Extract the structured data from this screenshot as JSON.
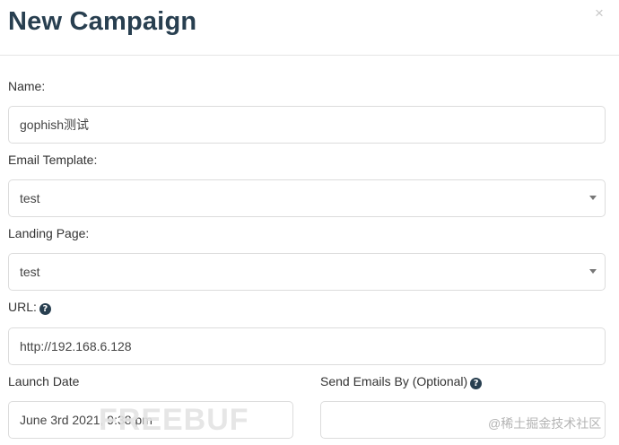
{
  "modal": {
    "title": "New Campaign",
    "close_glyph": "×"
  },
  "form": {
    "name": {
      "label": "Name:",
      "value": "gophish测试"
    },
    "email_template": {
      "label": "Email Template:",
      "value": "test"
    },
    "landing_page": {
      "label": "Landing Page:",
      "value": "test"
    },
    "url": {
      "label": "URL:",
      "value": "http://192.168.6.128",
      "help_glyph": "?"
    },
    "launch_date": {
      "label": "Launch Date",
      "value": "June 3rd 2021, 9:38 pm"
    },
    "send_emails_by": {
      "label": "Send Emails By (Optional)",
      "value": "",
      "help_glyph": "?"
    }
  },
  "watermark": {
    "logo": "FREEBUF",
    "text": "@稀土掘金技术社区"
  },
  "icons": {
    "close": "close-icon",
    "dropdown": "chevron-down-icon",
    "help": "question-circle-icon"
  },
  "colors": {
    "heading": "#283f50",
    "border": "#dcdcdc"
  }
}
